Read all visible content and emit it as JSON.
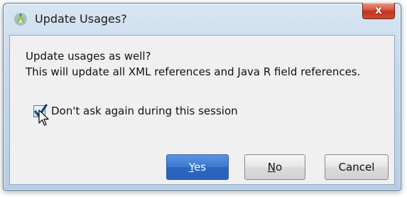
{
  "dialog": {
    "title": "Update Usages?",
    "app_icon": "android-studio-icon",
    "close_label": "x",
    "message_line1": "Update usages as well?",
    "message_line2": "This will update all XML references and Java R field references.",
    "checkbox": {
      "label": "Don't ask again during this session",
      "checked": true
    },
    "buttons": {
      "yes_mnemonic": "Y",
      "yes_rest": "es",
      "no_mnemonic": "N",
      "no_rest": "o",
      "cancel": "Cancel"
    }
  },
  "colors": {
    "primary_button": "#3d78cf",
    "close_button": "#c1351c",
    "app_icon_green": "#8bc34a"
  }
}
